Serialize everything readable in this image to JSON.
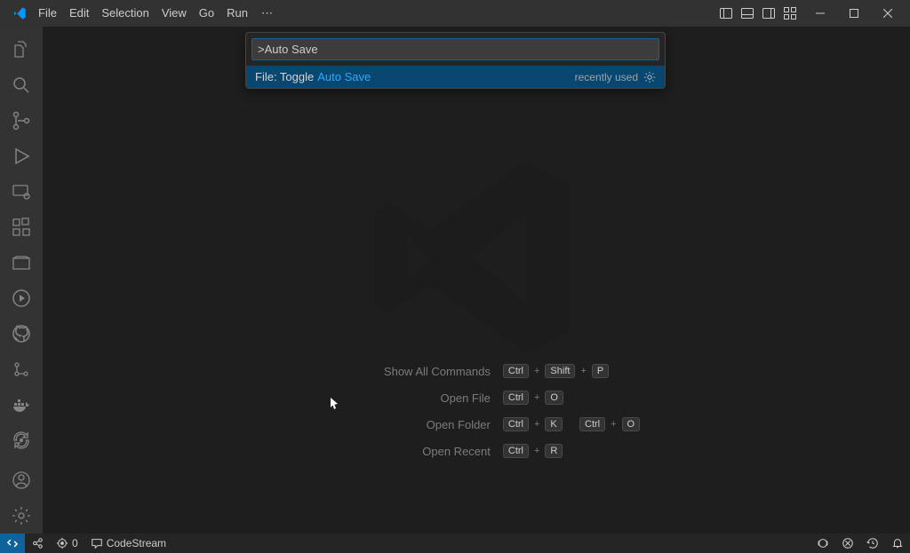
{
  "menubar": {
    "items": [
      "File",
      "Edit",
      "Selection",
      "View",
      "Go",
      "Run"
    ],
    "overflow": "⋯"
  },
  "palette": {
    "input_value": ">Auto Save",
    "result_prefix": "File: Toggle ",
    "result_highlight": "Auto Save",
    "recently_used": "recently used"
  },
  "hints": {
    "row0": {
      "label": "Show All Commands",
      "k0": "Ctrl",
      "k1": "Shift",
      "k2": "P"
    },
    "row1": {
      "label": "Open File",
      "k0": "Ctrl",
      "k1": "O"
    },
    "row2": {
      "label": "Open Folder",
      "k0": "Ctrl",
      "k1": "K",
      "k2": "Ctrl",
      "k3": "O"
    },
    "row3": {
      "label": "Open Recent",
      "k0": "Ctrl",
      "k1": "R"
    }
  },
  "statusbar": {
    "ports": "0",
    "codestream": "CodeStream"
  }
}
